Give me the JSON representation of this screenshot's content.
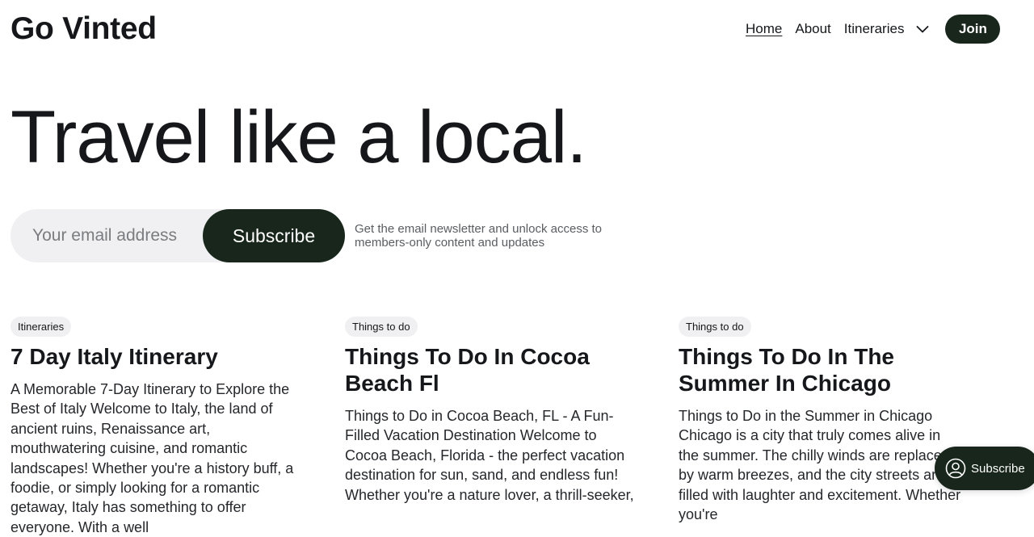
{
  "header": {
    "logo": "Go Vinted",
    "nav": {
      "home": "Home",
      "about": "About",
      "itineraries": "Itineraries",
      "join": "Join"
    }
  },
  "hero": {
    "title": "Travel like a local."
  },
  "subscribe": {
    "placeholder": "Your email address",
    "button": "Subscribe",
    "note": "Get the email newsletter and unlock access to members-only content and updates"
  },
  "posts": [
    {
      "tag": "Itineraries",
      "title": "7 Day Italy Itinerary",
      "excerpt": "A Memorable 7-Day Itinerary to Explore the Best of Italy Welcome to Italy, the land of ancient ruins, Renaissance art, mouthwatering cuisine, and romantic landscapes! Whether you're a history buff, a foodie, or simply looking for a romantic getaway, Italy has something to offer everyone. With a well"
    },
    {
      "tag": "Things to do",
      "title": "Things To Do In Cocoa Beach Fl",
      "excerpt": "Things to Do in Cocoa Beach, FL - A Fun-Filled Vacation Destination Welcome to Cocoa Beach, Florida - the perfect vacation destination for sun, sand, and endless fun! Whether you're a nature lover, a thrill-seeker,"
    },
    {
      "tag": "Things to do",
      "title": "Things To Do In The Summer In Chicago",
      "excerpt": "Things to Do in the Summer in Chicago Chicago is a city that truly comes alive in the summer. The chilly winds are replaced by warm breezes, and the city streets are filled with laughter and excitement. Whether you're"
    }
  ],
  "floating_button": {
    "label": "Subscribe"
  },
  "colors": {
    "accent": "#18261c",
    "pill_bg": "#f0eff2",
    "text": "#15171a"
  },
  "icons": {
    "nav_dropdown": "chevron-down-icon",
    "floating_button": "user-circle-icon"
  }
}
